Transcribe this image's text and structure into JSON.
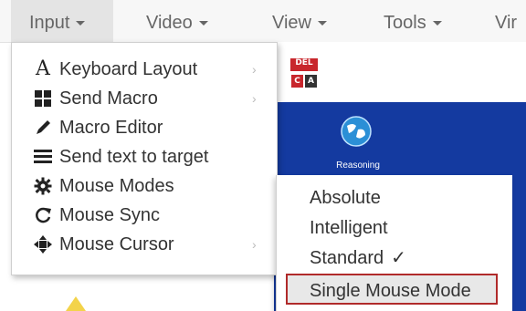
{
  "menubar": {
    "items": [
      {
        "label": "Input"
      },
      {
        "label": "Video"
      },
      {
        "label": "View"
      },
      {
        "label": "Tools"
      },
      {
        "label": "Vir"
      }
    ]
  },
  "input_menu": {
    "items": [
      {
        "label": "Keyboard Layout",
        "icon": "keyboard-layout-icon",
        "glyph": "A",
        "has_submenu": true
      },
      {
        "label": "Send Macro",
        "icon": "grid-icon",
        "has_submenu": true
      },
      {
        "label": "Macro Editor",
        "icon": "pencil-icon",
        "has_submenu": false
      },
      {
        "label": "Send text to target",
        "icon": "list-icon",
        "has_submenu": false
      },
      {
        "label": "Mouse Modes",
        "icon": "gear-icon",
        "has_submenu": false
      },
      {
        "label": "Mouse Sync",
        "icon": "refresh-icon",
        "has_submenu": false
      },
      {
        "label": "Mouse Cursor",
        "icon": "move-icon",
        "has_submenu": true
      }
    ],
    "submenu_arrow": "›"
  },
  "mouse_modes_menu": {
    "items": [
      {
        "label": "Absolute"
      },
      {
        "label": "Intelligent"
      },
      {
        "label": "Standard",
        "check": "✓"
      },
      {
        "label": "Single Mouse Mode",
        "highlighted": true
      }
    ]
  },
  "desktop": {
    "icon_label": "Reasoning",
    "del_icon": {
      "top": "DEL",
      "bottom_left": "C",
      "bottom_right": "A"
    }
  },
  "colors": {
    "desktop_blue": "#143aa0",
    "highlight_border": "#b02a2a",
    "menu_text": "#666666"
  }
}
